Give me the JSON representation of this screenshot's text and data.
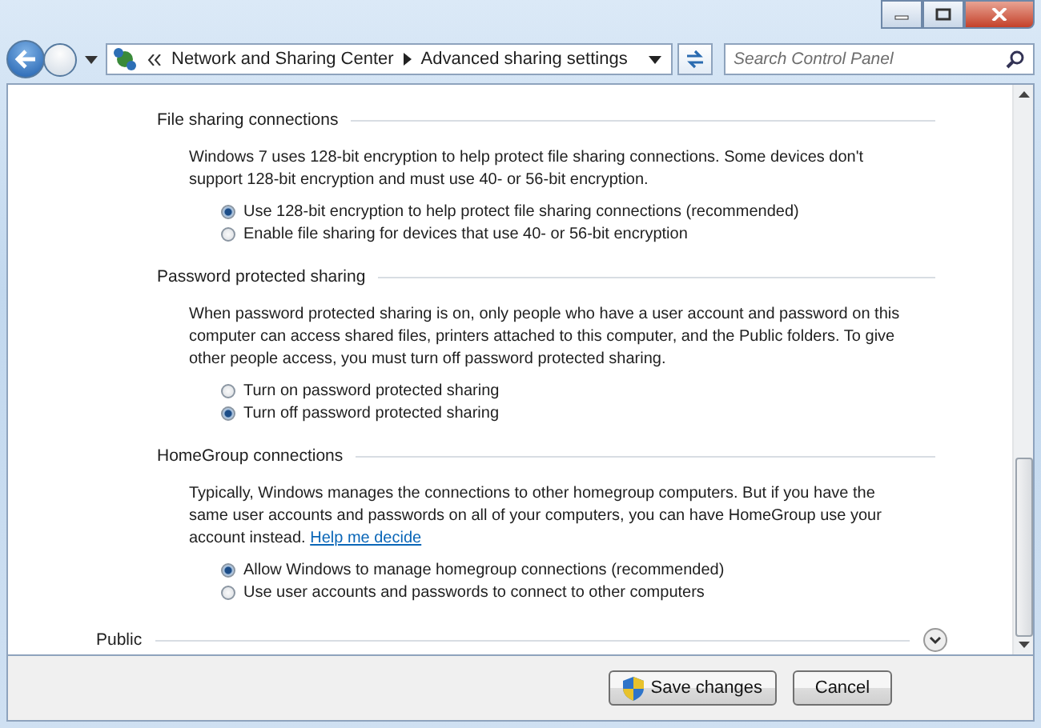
{
  "address_bar": {
    "breadcrumb": [
      "Network and Sharing Center",
      "Advanced sharing settings"
    ]
  },
  "search": {
    "placeholder": "Search Control Panel"
  },
  "sections": [
    {
      "title": "File sharing connections",
      "description": "Windows 7 uses 128-bit encryption to help protect file sharing connections. Some devices don't support 128-bit encryption and must use 40- or 56-bit encryption.",
      "options": [
        {
          "label": "Use 128-bit encryption to help protect file sharing connections (recommended)",
          "selected": true
        },
        {
          "label": "Enable file sharing for devices that use 40- or 56-bit encryption",
          "selected": false
        }
      ]
    },
    {
      "title": "Password protected sharing",
      "description": "When password protected sharing is on, only people who have a user account and password on this computer can access shared files, printers attached to this computer, and the Public folders. To give other people access, you must turn off password protected sharing.",
      "options": [
        {
          "label": "Turn on password protected sharing",
          "selected": false
        },
        {
          "label": "Turn off password protected sharing",
          "selected": true
        }
      ]
    },
    {
      "title": "HomeGroup connections",
      "description": "Typically, Windows manages the connections to other homegroup computers. But if you have the same user accounts and passwords on all of your computers, you can have HomeGroup use your account instead.",
      "link": "Help me decide",
      "options": [
        {
          "label": "Allow Windows to manage homegroup connections (recommended)",
          "selected": true
        },
        {
          "label": "Use user accounts and passwords to connect to other computers",
          "selected": false
        }
      ]
    }
  ],
  "collapsed_sections": [
    {
      "title": "Public",
      "expanded": false
    }
  ],
  "buttons": [
    {
      "label": "Save changes",
      "kind": "shield"
    },
    {
      "label": "Cancel",
      "kind": "plain"
    }
  ]
}
